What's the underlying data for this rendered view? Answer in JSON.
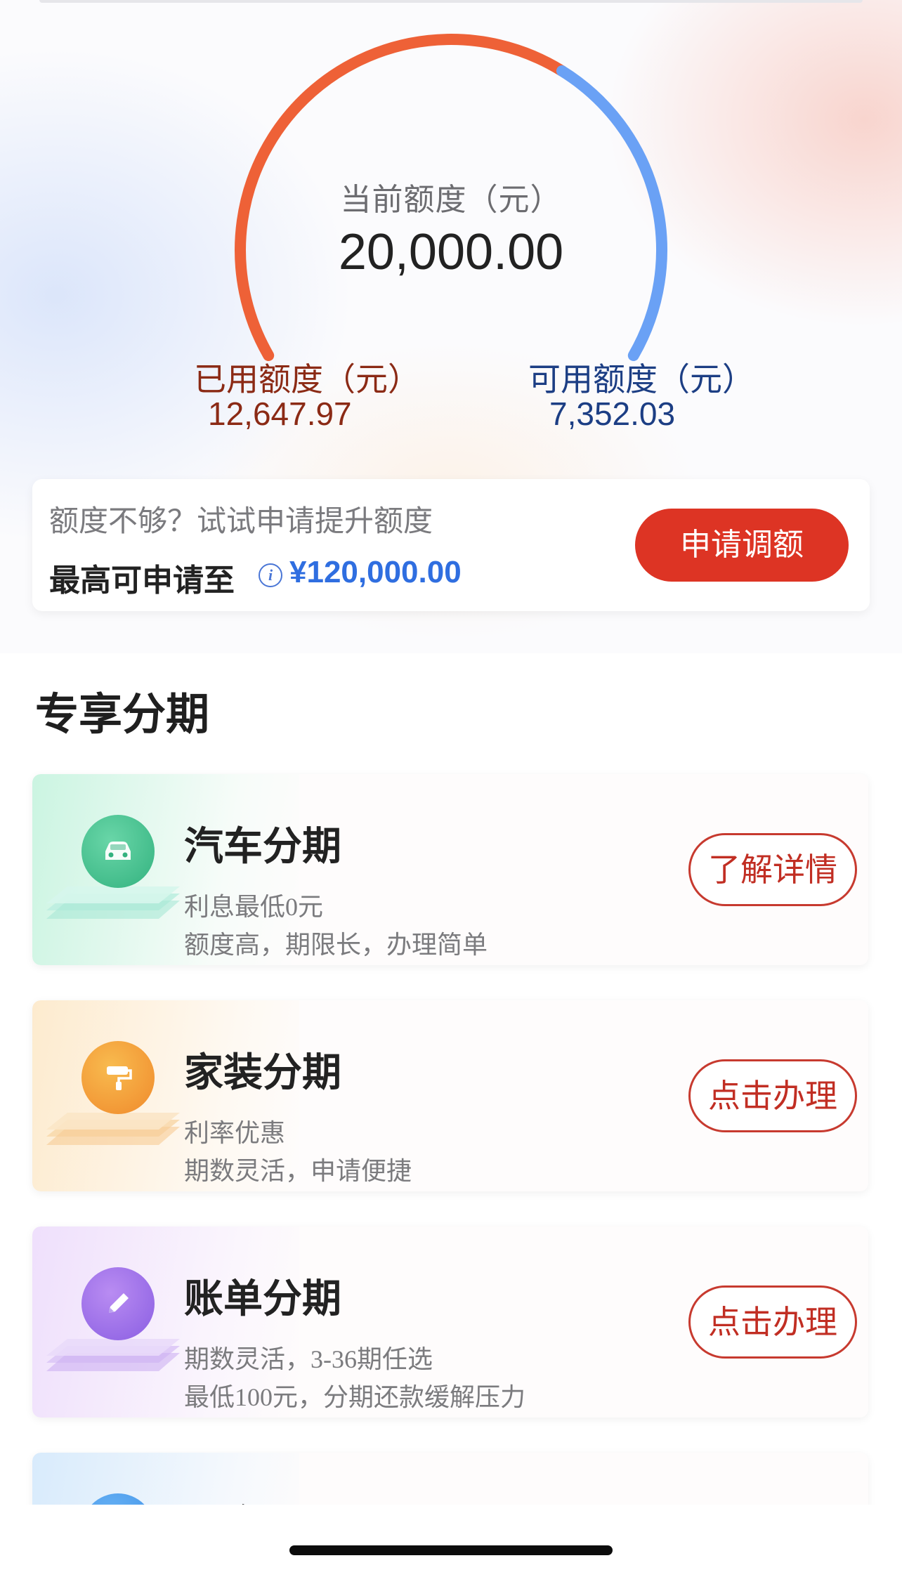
{
  "quota": {
    "current_label": "当前额度（元）",
    "current_value": "20,000.00",
    "used_label": "已用额度（元）",
    "used_value": "12,647.97",
    "available_label": "可用额度（元）",
    "available_value": "7,352.03",
    "used_color": "#ee6137",
    "available_color": "#6aa1f5"
  },
  "promo": {
    "question": "额度不够？试试申请提升额度",
    "max_label": "最高可申请至",
    "info_icon": "info-icon",
    "max_amount": "¥120,000.00",
    "button_label": "申请调额"
  },
  "section": {
    "title": "专享分期"
  },
  "plans": [
    {
      "name": "汽车分期",
      "line1": "利息最低0元",
      "line2": "额度高，期限长，办理简单",
      "button": "了解详情",
      "icon": "car-icon"
    },
    {
      "name": "家装分期",
      "line1": "利率优惠",
      "line2": "期数灵活，申请便捷",
      "button": "点击办理",
      "icon": "paint-roller-icon"
    },
    {
      "name": "账单分期",
      "line1": "期数灵活，3-36期任选",
      "line2": "最低100元，分期还款缓解压力",
      "button": "点击办理",
      "icon": "pencil-icon"
    },
    {
      "name": "现金分期",
      "icon": "cash-icon"
    }
  ]
}
